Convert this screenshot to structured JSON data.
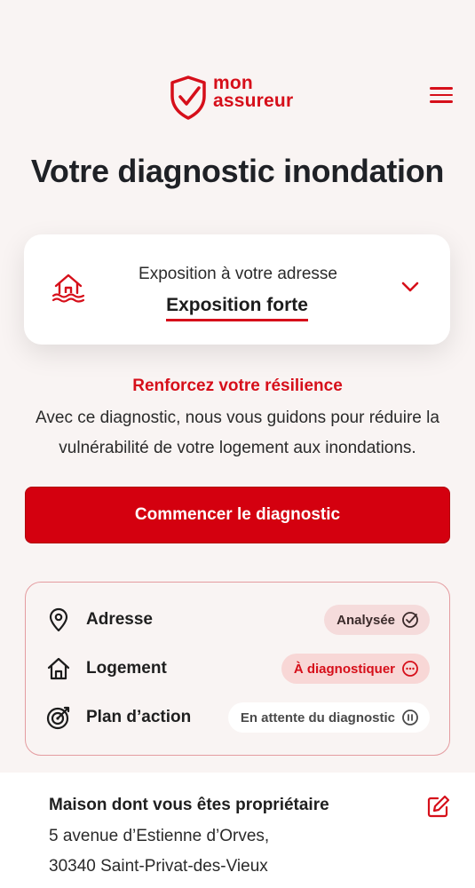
{
  "brand": {
    "line1": "mon",
    "line2": "assureur",
    "color": "#d60f1a"
  },
  "page": {
    "title": "Votre diagnostic inondation"
  },
  "exposure": {
    "label": "Exposition à votre adresse",
    "value": "Exposition forte",
    "icon": "flood-house-icon"
  },
  "resilience": {
    "title": "Renforcez votre résilience",
    "text": "Avec ce diagnostic, nous vous guidons pour réduire la vulnérabilité de votre logement aux inondations."
  },
  "cta": {
    "label": "Commencer le diagnostic"
  },
  "steps": [
    {
      "label": "Adresse",
      "status": "Analysée",
      "icon": "location-pin-icon",
      "status_icon": "check-circle-icon"
    },
    {
      "label": "Logement",
      "status": "À diagnostiquer",
      "icon": "house-icon",
      "status_icon": "more-circle-icon"
    },
    {
      "label": "Plan d’action",
      "status": "En attente du diagnostic",
      "icon": "target-icon",
      "status_icon": "pause-circle-icon"
    }
  ],
  "property": {
    "title": "Maison dont vous êtes propriétaire",
    "address_line1": "5 avenue d’Estienne d’Orves,",
    "address_line2": "30340 Saint-Privat-des-Vieux"
  },
  "colors": {
    "accent": "#d60f1a",
    "background": "#f9f4f3",
    "badge_bg": "#f8d7d6"
  }
}
